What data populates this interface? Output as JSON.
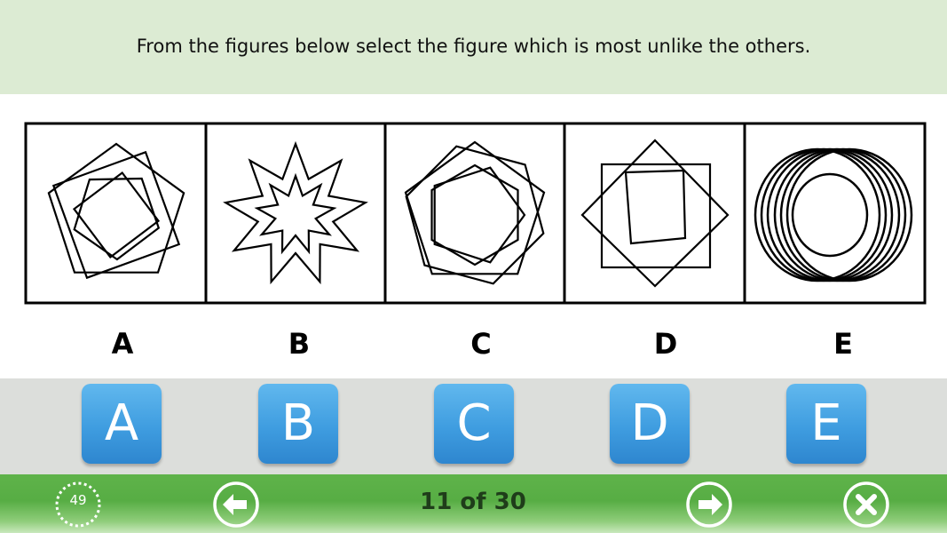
{
  "question": {
    "text": "From the figures below select the figure which is most unlike the others."
  },
  "figures": {
    "labels": [
      "A",
      "B",
      "C",
      "D",
      "E"
    ]
  },
  "answers": {
    "buttons": [
      "A",
      "B",
      "C",
      "D",
      "E"
    ],
    "color": "#3f9de0"
  },
  "footer": {
    "timer": "49",
    "progress": "11 of 30",
    "colors": {
      "bar": "#57ad44",
      "icon": "#ffffff"
    }
  },
  "icons": [
    "timer-icon",
    "previous-arrow-icon",
    "next-arrow-icon",
    "close-icon"
  ]
}
